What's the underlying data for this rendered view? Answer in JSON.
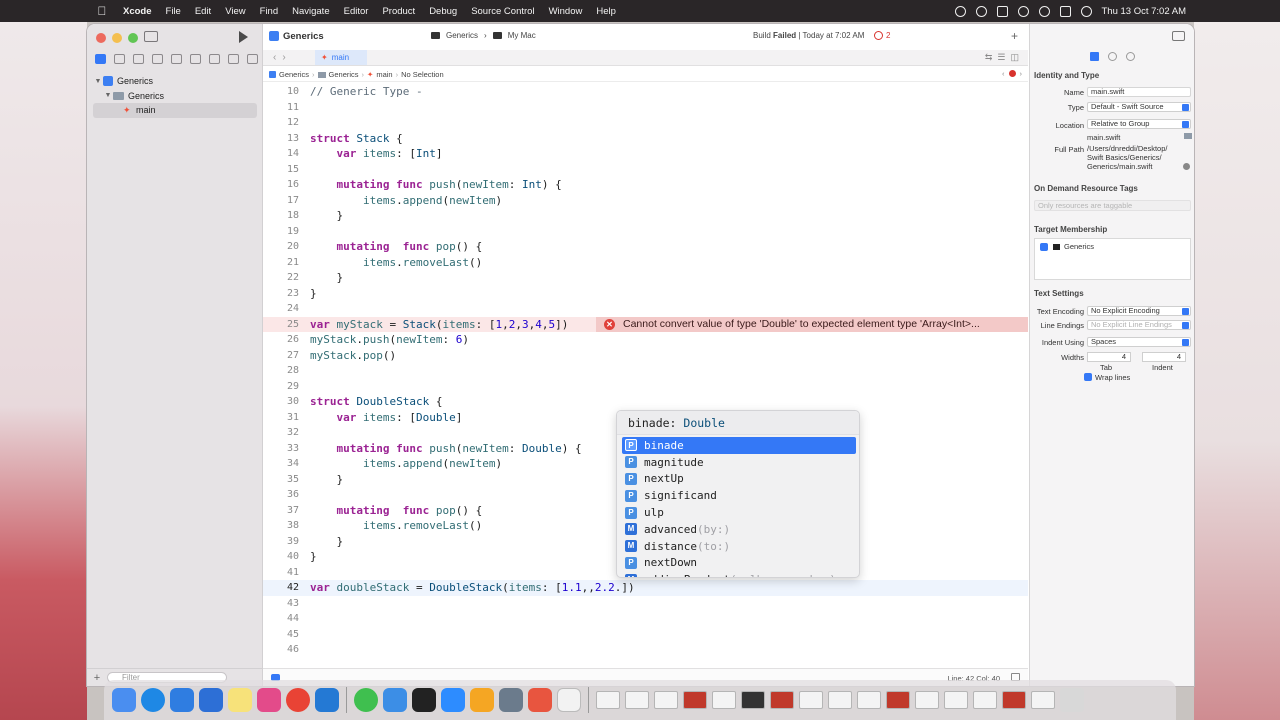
{
  "menubar": {
    "app": "Xcode",
    "items": [
      "File",
      "Edit",
      "View",
      "Find",
      "Navigate",
      "Editor",
      "Product",
      "Debug",
      "Source Control",
      "Window",
      "Help"
    ],
    "clock": "Thu 13 Oct  7:02 AM"
  },
  "navigator": {
    "project": "Generics",
    "group": "Generics",
    "file": "main",
    "filter_placeholder": "Filter"
  },
  "toolbar": {
    "project_title": "Generics",
    "scheme": "Generics",
    "destination": "My Mac",
    "status_prefix": "Build",
    "status_bold": "Failed",
    "status_suffix": "| Today at 7:02 AM",
    "error_count": "2"
  },
  "tab": {
    "label": "main"
  },
  "jumpbar": {
    "crumbs": [
      "Generics",
      "Generics",
      "main",
      "No Selection"
    ]
  },
  "editor": {
    "error_message": "Cannot convert value of type 'Double' to expected element type 'Array<Int>...",
    "footer": "Line: 42  Col: 40"
  },
  "code_lines": [
    {
      "n": "10",
      "t": "// Generic Type -"
    },
    {
      "n": "11",
      "t": ""
    },
    {
      "n": "12",
      "t": ""
    },
    {
      "n": "13",
      "t": "struct Stack {"
    },
    {
      "n": "14",
      "t": "    var items: [Int]"
    },
    {
      "n": "15",
      "t": ""
    },
    {
      "n": "16",
      "t": "    mutating func push(newItem: Int) {"
    },
    {
      "n": "17",
      "t": "        items.append(newItem)"
    },
    {
      "n": "18",
      "t": "    }"
    },
    {
      "n": "19",
      "t": ""
    },
    {
      "n": "20",
      "t": "    mutating  func pop() {"
    },
    {
      "n": "21",
      "t": "        items.removeLast()"
    },
    {
      "n": "22",
      "t": "    }"
    },
    {
      "n": "23",
      "t": "}"
    },
    {
      "n": "24",
      "t": ""
    },
    {
      "n": "25",
      "t": "var myStack = Stack(items: [1,2,3,4,5])"
    },
    {
      "n": "26",
      "t": "myStack.push(newItem: 6)"
    },
    {
      "n": "27",
      "t": "myStack.pop()"
    },
    {
      "n": "28",
      "t": ""
    },
    {
      "n": "29",
      "t": ""
    },
    {
      "n": "30",
      "t": "struct DoubleStack {"
    },
    {
      "n": "31",
      "t": "    var items: [Double]"
    },
    {
      "n": "32",
      "t": ""
    },
    {
      "n": "33",
      "t": "    mutating func push(newItem: Double) {"
    },
    {
      "n": "34",
      "t": "        items.append(newItem)"
    },
    {
      "n": "35",
      "t": "    }"
    },
    {
      "n": "36",
      "t": ""
    },
    {
      "n": "37",
      "t": "    mutating  func pop() {"
    },
    {
      "n": "38",
      "t": "        items.removeLast()"
    },
    {
      "n": "39",
      "t": "    }"
    },
    {
      "n": "40",
      "t": "}"
    },
    {
      "n": "41",
      "t": ""
    },
    {
      "n": "42",
      "t": "var doubleStack = DoubleStack(items: [1.1,,2.2.])"
    },
    {
      "n": "43",
      "t": ""
    },
    {
      "n": "44",
      "t": ""
    },
    {
      "n": "45",
      "t": ""
    },
    {
      "n": "46",
      "t": ""
    }
  ],
  "completion": {
    "header_name": "binade",
    "header_type": "Double",
    "items": [
      {
        "kind": "P",
        "label": "binade",
        "params": ""
      },
      {
        "kind": "P",
        "label": "magnitude",
        "params": ""
      },
      {
        "kind": "P",
        "label": "nextUp",
        "params": ""
      },
      {
        "kind": "P",
        "label": "significand",
        "params": ""
      },
      {
        "kind": "P",
        "label": "ulp",
        "params": ""
      },
      {
        "kind": "M",
        "label": "advanced",
        "params": "(by:)"
      },
      {
        "kind": "M",
        "label": "distance",
        "params": "(to:)"
      },
      {
        "kind": "P",
        "label": "nextDown",
        "params": ""
      },
      {
        "kind": "M",
        "label": "addingProduct",
        "params": "(_ lhs:, _ rhs:)"
      }
    ]
  },
  "inspector": {
    "identity_title": "Identity and Type",
    "name_label": "Name",
    "name_value": "main.swift",
    "type_label": "Type",
    "type_value": "Default - Swift Source",
    "location_label": "Location",
    "location_value": "Relative to Group",
    "location_file": "main.swift",
    "fullpath_label": "Full Path",
    "fullpath_lines": [
      "/Users/dnreddi/Desktop/",
      "Swift Basics/Generics/",
      "Generics/main.swift"
    ],
    "odr_title": "On Demand Resource Tags",
    "odr_placeholder": "Only resources are taggable",
    "target_title": "Target Membership",
    "target_name": "Generics",
    "text_title": "Text Settings",
    "encoding_label": "Text Encoding",
    "encoding_value": "No Explicit Encoding",
    "endings_label": "Line Endings",
    "endings_value": "No Explicit Line Endings",
    "indent_label": "Indent Using",
    "indent_value": "Spaces",
    "widths_label": "Widths",
    "tab_width": "4",
    "indent_width": "4",
    "tab_caption": "Tab",
    "indent_caption": "Indent",
    "wrap_label": "Wrap lines"
  },
  "colors": {
    "accent": "#3478f6",
    "error": "#e0403a",
    "keyword": "#9b2393"
  }
}
